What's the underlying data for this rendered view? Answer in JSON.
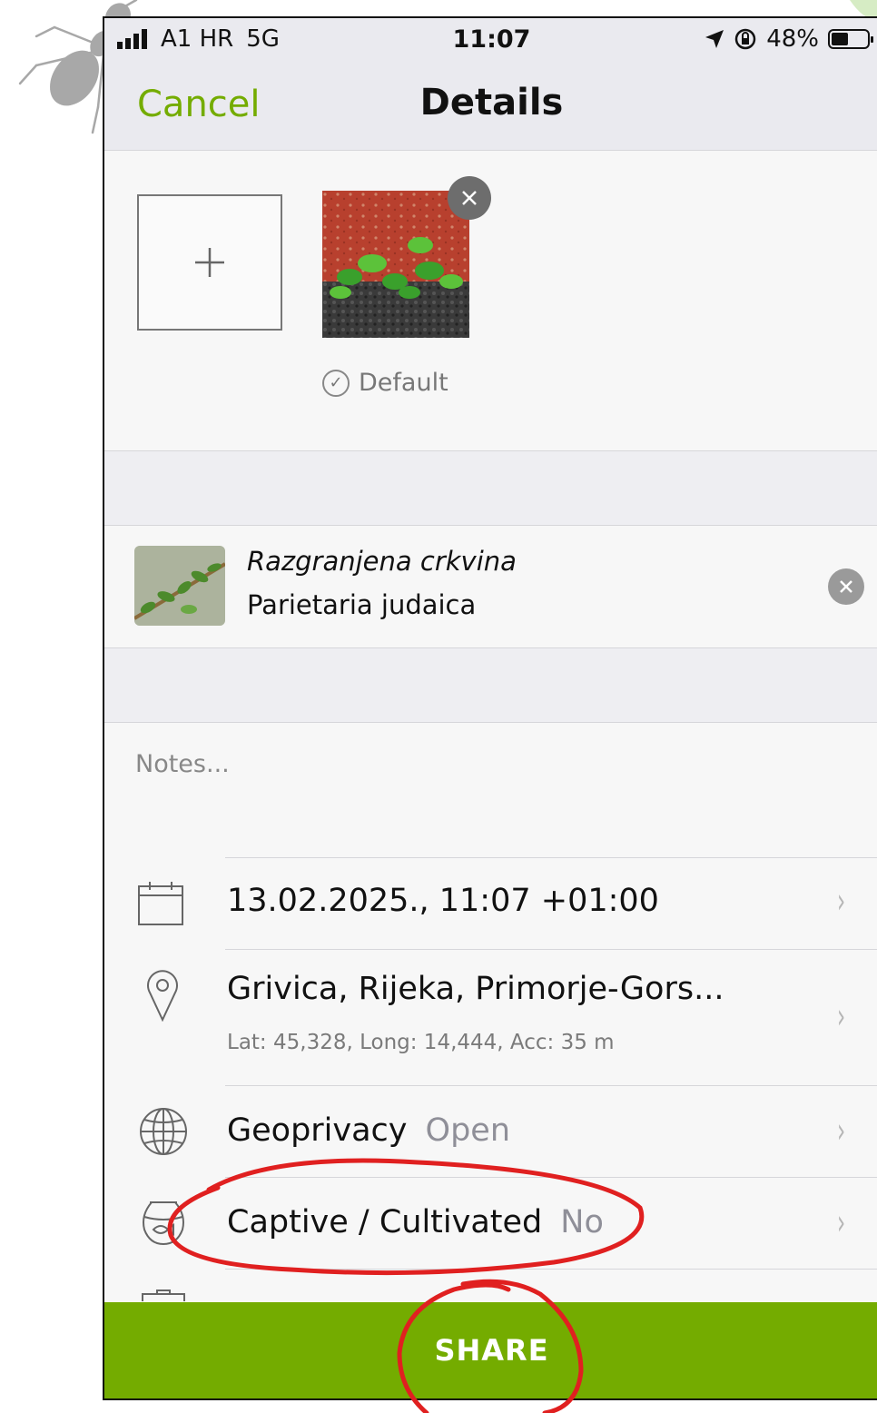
{
  "status_bar": {
    "carrier": "A1 HR",
    "network": "5G",
    "time": "11:07",
    "battery": "48%",
    "battery_level": 0.48,
    "icons": [
      "signal-icon",
      "location-arrow-icon",
      "rotation-lock-icon",
      "battery-icon"
    ]
  },
  "nav": {
    "cancel_label": "Cancel",
    "title": "Details"
  },
  "photos": {
    "add_icon": "plus-icon",
    "remove_icon": "close-icon",
    "default_label": "Default"
  },
  "taxon": {
    "common_name": "Razgranjena crkvina",
    "scientific_name": "Parietaria judaica"
  },
  "notes": {
    "placeholder": "Notes..."
  },
  "rows": {
    "date": "13.02.2025., 11:07 +01:00",
    "location": "Grivica, Rijeka, Primorje-Gors...",
    "location_detail": "Lat: 45,328, Long: 14,444, Acc: 35 m",
    "geoprivacy_label": "Geoprivacy",
    "geoprivacy_value": "Open",
    "captive_label": "Captive / Cultivated",
    "captive_value": "No"
  },
  "share_label": "SHARE",
  "colors": {
    "accent": "#74ac00",
    "annotation": "#e02020"
  }
}
